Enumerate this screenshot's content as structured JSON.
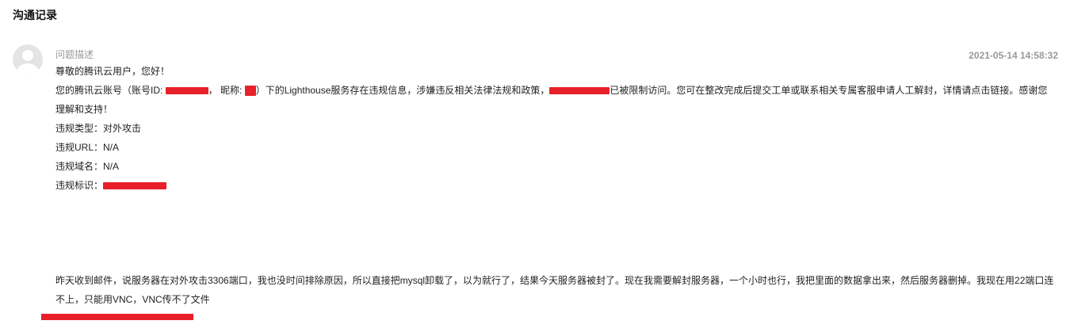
{
  "section": {
    "title": "沟通记录"
  },
  "message": {
    "label": "问题描述",
    "timestamp": "2021-05-14 14:58:32",
    "greeting": "尊敬的腾讯云用户，您好！",
    "notice": {
      "prefix": "您的腾讯云账号（账号ID: ",
      "nickname_label": "，  昵称: ",
      "body": "）下的Lighthouse服务存在违规信息，涉嫌违反相关法律法规和政策，",
      "suffix": "已被限制访问。您可在整改完成后提交工单或联系相关专属客服申请人工解封，详情请点击链接。感谢您理解和支持！"
    },
    "violation_type": "违规类型：对外攻击",
    "violation_url": "违规URL：N/A",
    "violation_domain": "违规域名：N/A",
    "violation_id_label": "违规标识："
  },
  "user_reply": {
    "text": "昨天收到邮件，说服务器在对外攻击3306端口，我也没时间排除原因，所以直接把mysql卸载了，以为就行了，结果今天服务器被封了。现在我需要解封服务器，一个小时也行，我把里面的数据拿出来，然后服务器删掉。我现在用22端口连不上，只能用VNC，VNC传不了文件"
  },
  "colors": {
    "redaction": "#e8202a",
    "muted_text": "#999999"
  }
}
